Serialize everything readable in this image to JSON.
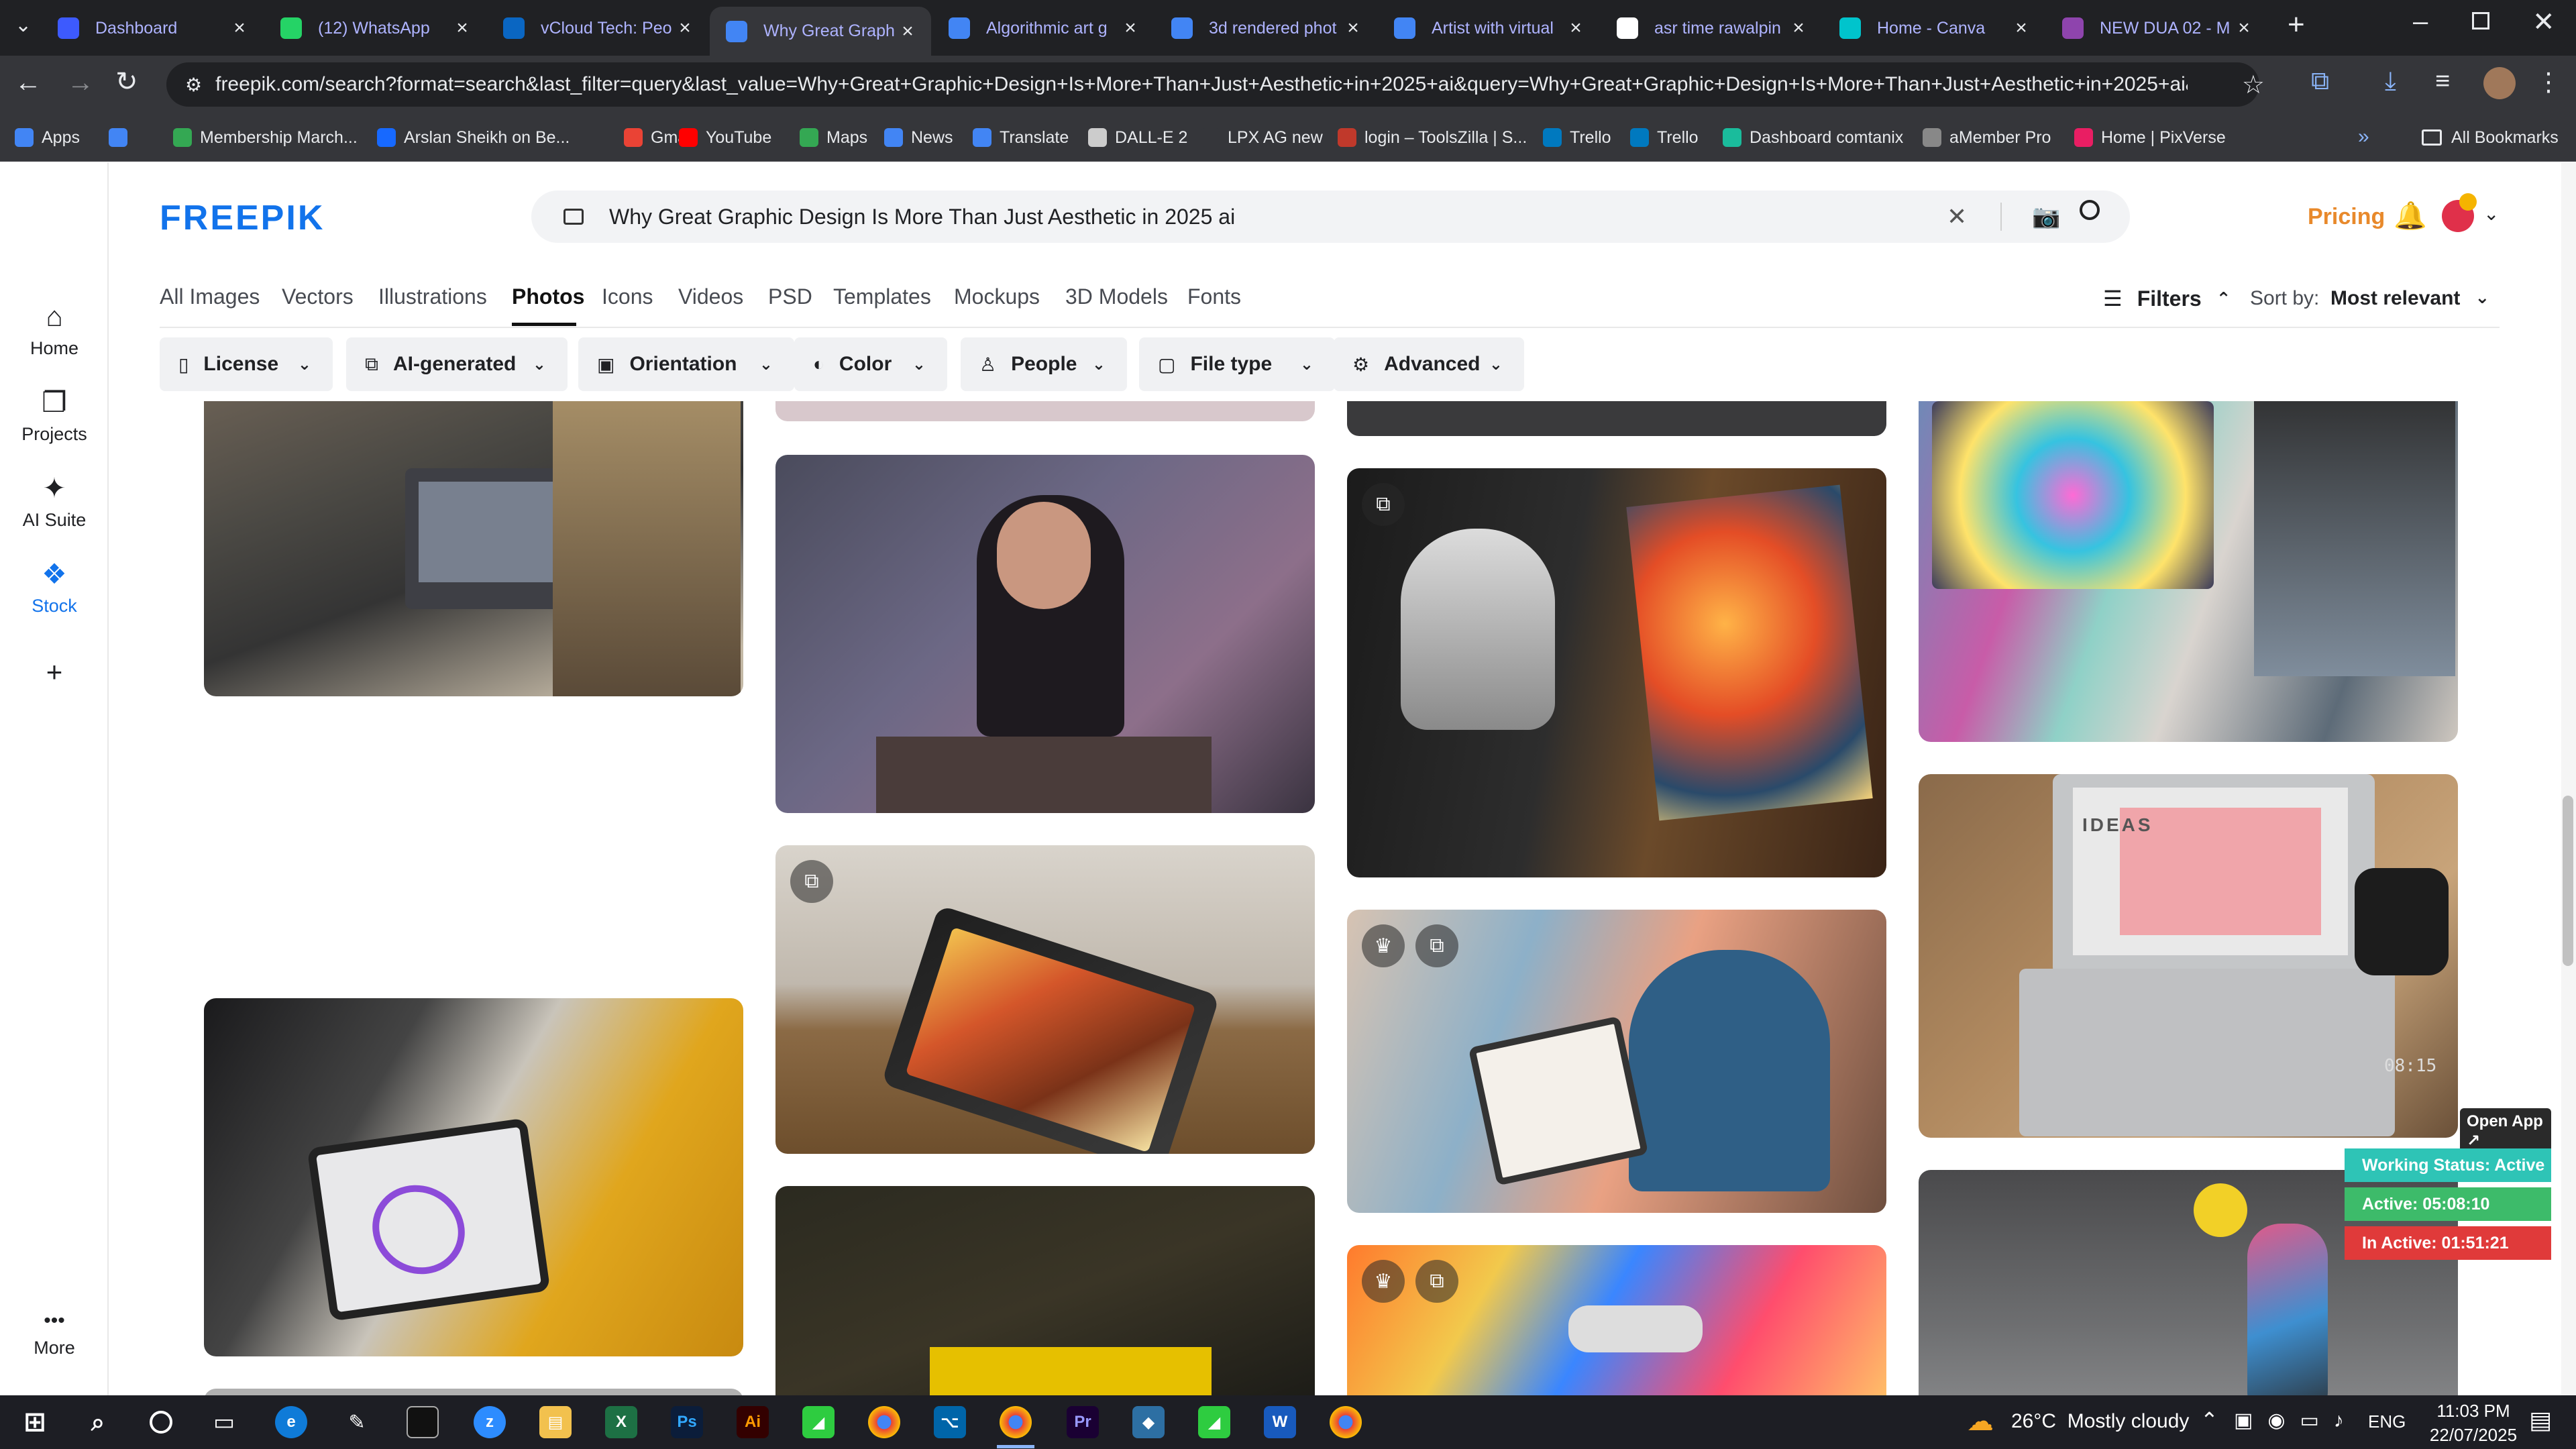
{
  "browser": {
    "tabs": [
      {
        "title": "Dashboard",
        "icon": "dashboard-favicon",
        "color": "#3d5afe"
      },
      {
        "title": "(12) WhatsApp",
        "icon": "whatsapp-favicon",
        "color": "#25d366"
      },
      {
        "title": "vCloud Tech: Peo",
        "icon": "linkedin-favicon",
        "color": "#0a66c2"
      },
      {
        "title": "Why Great Graph",
        "icon": "docs-favicon",
        "color": "#4285f4",
        "active": true
      },
      {
        "title": "Algorithmic art g",
        "icon": "docs-favicon",
        "color": "#4285f4"
      },
      {
        "title": "3d rendered phot",
        "icon": "docs-favicon",
        "color": "#4285f4"
      },
      {
        "title": "Artist with virtual",
        "icon": "docs-favicon",
        "color": "#4285f4"
      },
      {
        "title": "asr time rawalpin",
        "icon": "google-favicon",
        "color": "#ffffff"
      },
      {
        "title": "Home - Canva",
        "icon": "canva-favicon",
        "color": "#00c4cc"
      },
      {
        "title": "NEW DUA 02 - M",
        "icon": "video-favicon",
        "color": "#8e44ad"
      }
    ],
    "url": "freepik.com/search?format=search&last_filter=query&last_value=Why+Great+Graphic+Design+Is+More+Than+Just+Aesthetic+in+2025+ai&query=Why+Great+Graphic+Design+Is+More+Than+Just+Aesthetic+in+2025+ai&type=photo",
    "bookmarks": [
      {
        "label": "Apps",
        "icon": "apps-grid-icon",
        "color": "#4285f4"
      },
      {
        "label": "",
        "icon": "grid-icon",
        "color": "#4285f4"
      },
      {
        "label": "Membership March...",
        "icon": "bookmark-icon",
        "color": "#34a853"
      },
      {
        "label": "Arslan Sheikh on Be...",
        "icon": "behance-icon",
        "color": "#1769ff"
      },
      {
        "label": "Gmail",
        "icon": "gmail-icon",
        "color": "#ea4335"
      },
      {
        "label": "YouTube",
        "icon": "youtube-icon",
        "color": "#ff0000"
      },
      {
        "label": "Maps",
        "icon": "maps-icon",
        "color": "#34a853"
      },
      {
        "label": "News",
        "icon": "news-icon",
        "color": "#4285f4"
      },
      {
        "label": "Translate",
        "icon": "translate-icon",
        "color": "#4285f4"
      },
      {
        "label": "DALL-E 2",
        "icon": "openai-icon",
        "color": "#cccccc"
      },
      {
        "label": "LPX AG new",
        "icon": "bookmark-icon",
        "color": "#35363a"
      },
      {
        "label": "login – ToolsZilla | S...",
        "icon": "toolszilla-icon",
        "color": "#c0392b"
      },
      {
        "label": "Trello",
        "icon": "trello-icon",
        "color": "#0079bf"
      },
      {
        "label": "Trello",
        "icon": "trello-icon",
        "color": "#0079bf"
      },
      {
        "label": "Dashboard comtanix",
        "icon": "comtanix-icon",
        "color": "#1abc9c"
      },
      {
        "label": "aMember Pro",
        "icon": "amember-icon",
        "color": "#888888"
      },
      {
        "label": "Home | PixVerse",
        "icon": "pixverse-icon",
        "color": "#e91e63"
      }
    ],
    "all_bookmarks": "All Bookmarks"
  },
  "freepik": {
    "logo": "FREEPIK",
    "rail": [
      {
        "label": "Home",
        "icon": "home-icon"
      },
      {
        "label": "Projects",
        "icon": "projects-icon"
      },
      {
        "label": "AI Suite",
        "icon": "ai-suite-icon"
      },
      {
        "label": "Stock",
        "icon": "stock-icon",
        "active": true
      },
      {
        "label": "",
        "icon": "plus-icon"
      },
      {
        "label": "More",
        "icon": "more-dots-icon"
      }
    ],
    "search_query": "Why Great Graphic Design Is More Than Just Aesthetic in 2025 ai",
    "pricing": "Pricing",
    "type_tabs": [
      "All Images",
      "Vectors",
      "Illustrations",
      "Photos",
      "Icons",
      "Videos",
      "PSD",
      "Templates",
      "Mockups",
      "3D Models",
      "Fonts"
    ],
    "active_tab": "Photos",
    "filters_label": "Filters",
    "sort_label": "Sort by:",
    "sort_value": "Most relevant",
    "filters": [
      {
        "label": "License",
        "icon": "license-icon"
      },
      {
        "label": "AI-generated",
        "icon": "ai-generated-icon"
      },
      {
        "label": "Orientation",
        "icon": "orientation-icon"
      },
      {
        "label": "Color",
        "icon": "color-palette-icon"
      },
      {
        "label": "People",
        "icon": "people-icon"
      },
      {
        "label": "File type",
        "icon": "file-type-icon"
      },
      {
        "label": "Advanced",
        "icon": "advanced-gear-icon"
      }
    ],
    "overlay_text": {
      "ideas": "IDEAS",
      "clock": "08:15"
    }
  },
  "status_widget": {
    "open_app": "Open App ↗",
    "working": "Working Status: Active",
    "active": "Active: 05:08:10",
    "inactive": "In Active: 01:51:21",
    "colors": {
      "working": "#2ec4b6",
      "active": "#3dbb6a",
      "inactive": "#e03a3a"
    }
  },
  "taskbar": {
    "weather": "26°C  Mostly cloudy",
    "lang": "ENG",
    "time": "11:03 PM",
    "date": "22/07/2025"
  }
}
